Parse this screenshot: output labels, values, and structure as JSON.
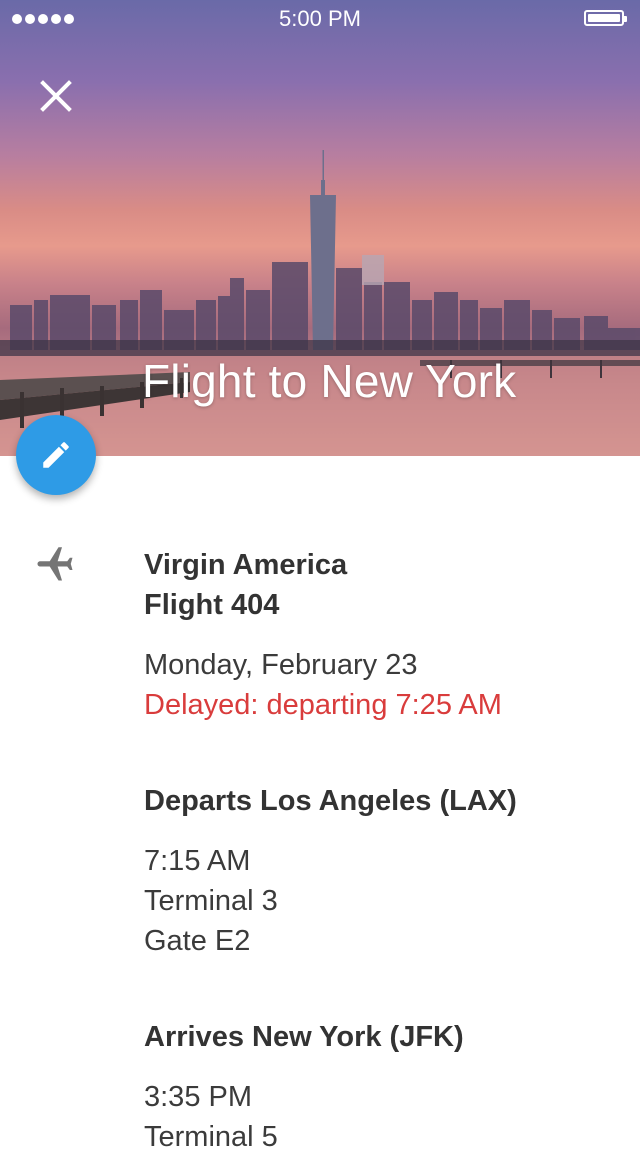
{
  "status_bar": {
    "time": "5:00 PM",
    "signal_dots": 5,
    "battery_level": 1.0
  },
  "header": {
    "title": "Flight to New York",
    "close_icon": "close-icon",
    "edit_icon": "pencil-icon"
  },
  "flight": {
    "icon": "airplane-icon",
    "airline": "Virgin America",
    "number": "Flight 404",
    "date": "Monday, February 23",
    "status": "Delayed: departing 7:25 AM"
  },
  "departure": {
    "heading": "Departs Los Angeles (LAX)",
    "time": "7:15 AM",
    "terminal": "Terminal 3",
    "gate": "Gate E2"
  },
  "arrival": {
    "heading": "Arrives New York (JFK)",
    "time": "3:35 PM",
    "terminal": "Terminal 5"
  },
  "colors": {
    "accent": "#2e9be6",
    "alert": "#d93c3c",
    "text": "#333333"
  }
}
